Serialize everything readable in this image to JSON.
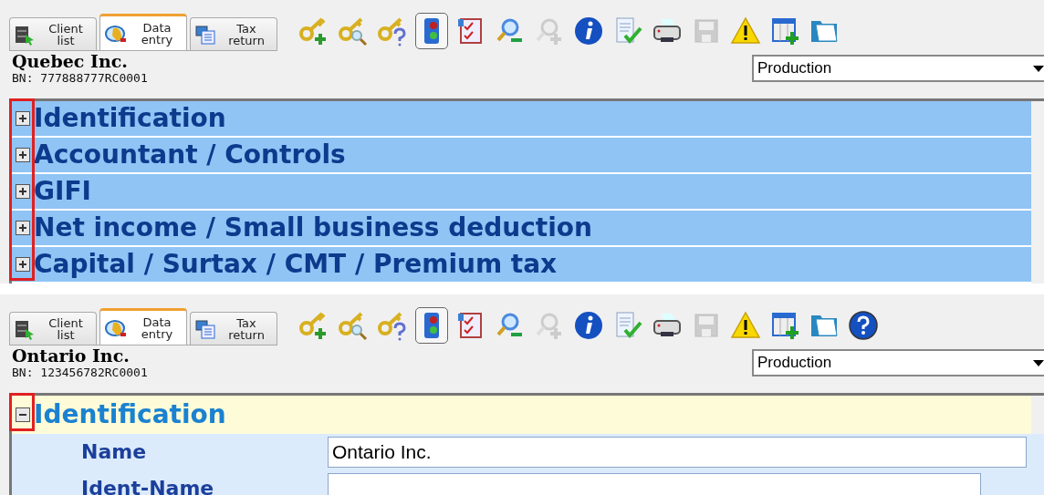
{
  "panels": [
    {
      "tabs": [
        {
          "label": "Client list",
          "selected": false
        },
        {
          "label": "Data entry",
          "selected": true
        },
        {
          "label": "Tax return",
          "selected": false
        }
      ],
      "help_button": false,
      "company": "Quebec Inc.",
      "bn": "BN: 777888777RC0001",
      "environment": "Production",
      "expanders_marked": true,
      "sections": [
        {
          "title": "Identification",
          "expanded": false
        },
        {
          "title": "Accountant / Controls",
          "expanded": false
        },
        {
          "title": "GIFI",
          "expanded": false
        },
        {
          "title": "Net income / Small business deduction",
          "expanded": false
        },
        {
          "title": "Capital / Surtax / CMT / Premium tax",
          "expanded": false
        }
      ]
    },
    {
      "tabs": [
        {
          "label": "Client list",
          "selected": false
        },
        {
          "label": "Data entry",
          "selected": true
        },
        {
          "label": "Tax return",
          "selected": false
        }
      ],
      "help_button": true,
      "company": "Ontario Inc.",
      "bn": "BN: 123456782RC0001",
      "environment": "Production",
      "expanders_marked": true,
      "sections": [
        {
          "title": "Identification",
          "expanded": true,
          "fields": [
            {
              "label": "Name",
              "value": "Ontario Inc."
            },
            {
              "label": "Ident-Name"
            }
          ]
        }
      ]
    }
  ]
}
